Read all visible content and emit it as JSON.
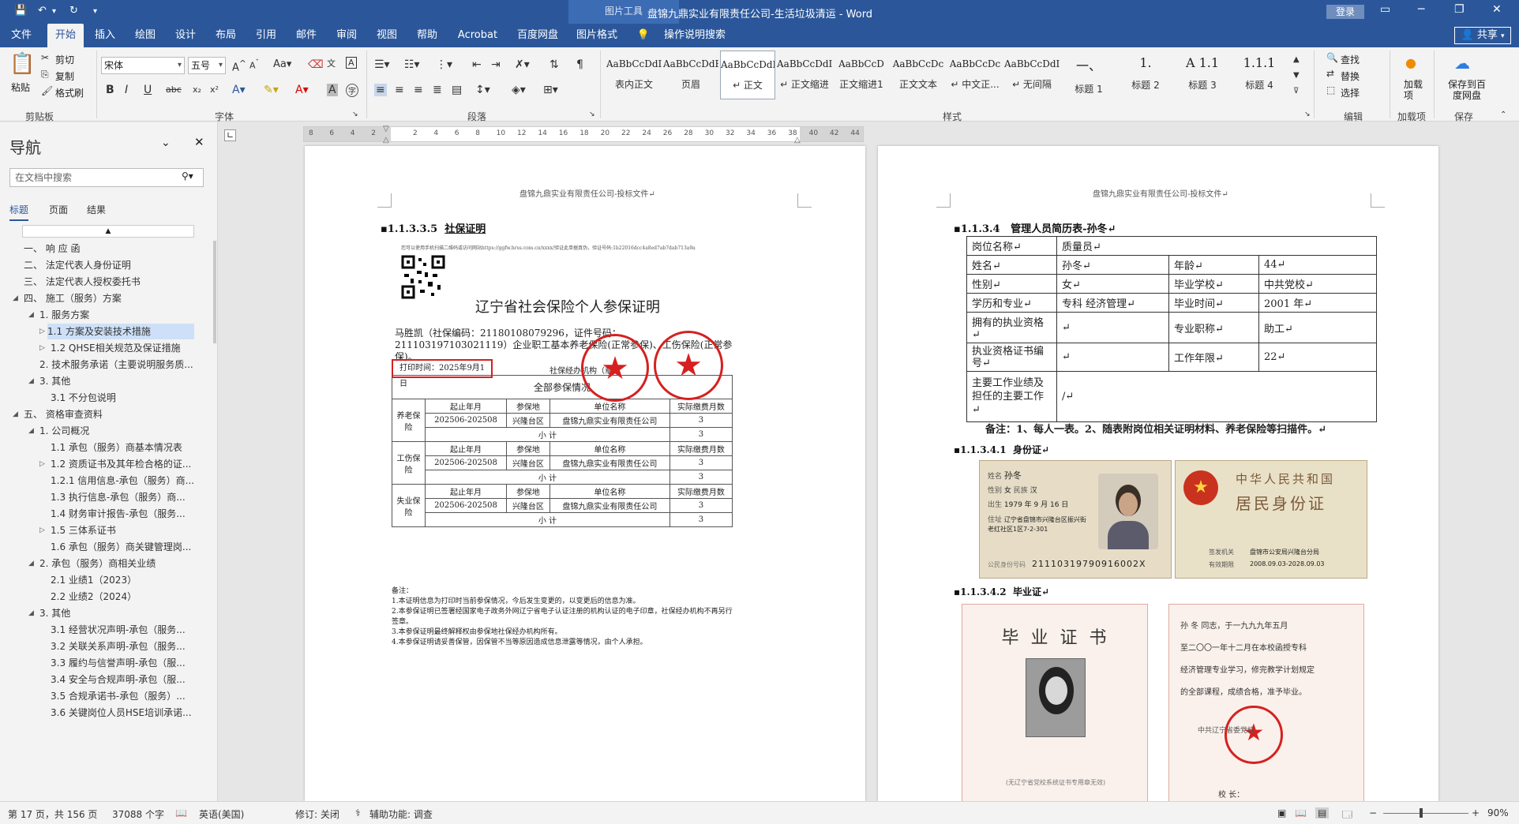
{
  "titlebar": {
    "context_tab": "图片工具",
    "document_title": "盘锦九鼎实业有限责任公司-生活垃圾清运 - Word",
    "login": "登录",
    "save_icon": "save-icon",
    "undo_icon": "undo-icon",
    "redo_icon": "redo-icon"
  },
  "tabs": [
    "文件",
    "开始",
    "插入",
    "绘图",
    "设计",
    "布局",
    "引用",
    "邮件",
    "审阅",
    "视图",
    "帮助",
    "Acrobat",
    "百度网盘",
    "图片格式"
  ],
  "tell_me": "操作说明搜索",
  "share": "共享",
  "ribbon": {
    "clipboard": {
      "paste": "粘贴",
      "cut": "剪切",
      "copy": "复制",
      "format_painter": "格式刷",
      "label": "剪贴板"
    },
    "font": {
      "name": "宋体",
      "size": "五号",
      "label": "字体"
    },
    "paragraph": {
      "label": "段落"
    },
    "styles": {
      "label": "样式",
      "items": [
        {
          "sample": "AaBbCcDdI",
          "name": "表内正文"
        },
        {
          "sample": "AaBbCcDdEe",
          "name": "页眉"
        },
        {
          "sample": "AaBbCcDdI",
          "name": "↵ 正文"
        },
        {
          "sample": "AaBbCcDdI",
          "name": "↵ 正文缩进"
        },
        {
          "sample": "AaBbCcD",
          "name": "正文缩进1"
        },
        {
          "sample": "AaBbCcDc",
          "name": "正文文本"
        },
        {
          "sample": "AaBbCcDc",
          "name": "↵ 中文正..."
        },
        {
          "sample": "AaBbCcDdI",
          "name": "↵ 无间隔"
        },
        {
          "sample": "一、",
          "name": "标题 1"
        },
        {
          "sample": "1.",
          "name": "标题 2"
        },
        {
          "sample": "A 1.1",
          "name": "标题 3"
        },
        {
          "sample": "1.1.1",
          "name": "标题 4"
        }
      ]
    },
    "editing": {
      "find": "查找",
      "replace": "替换",
      "select": "选择",
      "label": "编辑"
    },
    "addins": {
      "add": "加载项",
      "label": "加载项"
    },
    "save": {
      "btn": "保存到百度网盘",
      "label": "保存"
    }
  },
  "ruler_ticks": [
    "8",
    "6",
    "4",
    "2",
    "",
    "2",
    "4",
    "6",
    "8",
    "10",
    "12",
    "14",
    "16",
    "18",
    "20",
    "22",
    "24",
    "26",
    "28",
    "30",
    "32",
    "34",
    "36",
    "38",
    "40",
    "42",
    "44"
  ],
  "nav": {
    "title": "导航",
    "search_placeholder": "在文档中搜索",
    "tabs": [
      "标题",
      "页面",
      "结果"
    ],
    "items": [
      {
        "text": "一、 响 应 函",
        "indent": 0
      },
      {
        "text": "二、 法定代表人身份证明",
        "indent": 0
      },
      {
        "text": "三、 法定代表人授权委托书",
        "indent": 0
      },
      {
        "text": "四、 施工（服务）方案",
        "indent": 0,
        "caret": true
      },
      {
        "text": "1. 服务方案",
        "indent": 1,
        "caret": true
      },
      {
        "text": "1.1 方案及安装技术措施",
        "indent": 2,
        "caret": true,
        "selected": true
      },
      {
        "text": "1.2 QHSE相关规范及保证措施",
        "indent": 2,
        "caret": true
      },
      {
        "text": "2. 技术服务承诺（主要说明服务质...",
        "indent": 1
      },
      {
        "text": "3. 其他",
        "indent": 1,
        "caret": true
      },
      {
        "text": "3.1 不分包说明",
        "indent": 2
      },
      {
        "text": "五、 资格审查资料",
        "indent": 0,
        "caret": true
      },
      {
        "text": "1. 公司概况",
        "indent": 1,
        "caret": true
      },
      {
        "text": "1.1 承包（服务）商基本情况表",
        "indent": 2
      },
      {
        "text": "1.2 资质证书及其年检合格的证...",
        "indent": 2,
        "caret": true
      },
      {
        "text": "1.2.1 信用信息-承包（服务）商...",
        "indent": 2
      },
      {
        "text": "1.3 执行信息-承包（服务）商...",
        "indent": 2
      },
      {
        "text": "1.4 财务审计报告-承包（服务...",
        "indent": 2
      },
      {
        "text": "1.5 三体系证书",
        "indent": 2,
        "caret": true
      },
      {
        "text": "1.6 承包（服务）商关键管理岗...",
        "indent": 2
      },
      {
        "text": "2. 承包（服务）商相关业绩",
        "indent": 1,
        "caret": true
      },
      {
        "text": "2.1 业绩1（2023）",
        "indent": 2
      },
      {
        "text": "2.2 业绩2（2024）",
        "indent": 2
      },
      {
        "text": "3. 其他",
        "indent": 1,
        "caret": true
      },
      {
        "text": "3.1 经营状况声明-承包（服务...",
        "indent": 2
      },
      {
        "text": "3.2 关联关系声明-承包（服务...",
        "indent": 2
      },
      {
        "text": "3.3 履约与信誉声明-承包（服...",
        "indent": 2
      },
      {
        "text": "3.4 安全与合规声明-承包（服...",
        "indent": 2
      },
      {
        "text": "3.5 合规承诺书-承包（服务）...",
        "indent": 2
      },
      {
        "text": "3.6 关键岗位人员HSE培训承诺...",
        "indent": 2
      }
    ]
  },
  "page1": {
    "header": "盘锦九鼎实业有限责任公司-投标文件↵",
    "heading_num": "1.1.3.3.5",
    "heading_text": "社保证明",
    "verify_line": "您可以使用手机扫描二维码或访问网站https://ggfw.hrss.com.cn/xxxx/验证此单据真伪，验证号码:1b22016dcc4a8ed7ab7dab713a9a",
    "cert_title": "辽宁省社会保险个人参保证明",
    "cert_body": "马胜凯（社保编码：21180108079296，证件号码：211103197103021119）企业职工基本养老保险(正常参保)、工伤保险(正常参保)。",
    "print_time": "打印时间：2025年9月1日",
    "agency": "社保经办机构（章）",
    "table_title": "全部参保情况",
    "col_headers": [
      "起止年月",
      "参保地",
      "单位名称",
      "实际缴费月数"
    ],
    "rows": [
      {
        "type": "养老保险",
        "period": "202506-202508",
        "place": "兴隆台区",
        "unit": "盘锦九鼎实业有限责任公司",
        "months": "3"
      },
      {
        "type": "工伤保险",
        "period": "202506-202508",
        "place": "兴隆台区",
        "unit": "盘锦九鼎实业有限责任公司",
        "months": "3"
      },
      {
        "type": "失业保险",
        "period": "202506-202508",
        "place": "兴隆台区",
        "unit": "盘锦九鼎实业有限责任公司",
        "months": "3"
      }
    ],
    "subtotal_label": "小    计",
    "notes": [
      "备注：",
      "1.本证明信息为打印时当前参保情况，今后发生变更的，以变更后的信息为准。",
      "2.本参保证明已签署经国家电子政务外网辽宁省电子认证注册的机构认证的电子印章，社保经办机构不再另行签章。",
      "3.本参保证明最终解释权由参保地社保经办机构所有。",
      "4.本参保证明请妥善保管，因保管不当等原因造成信息泄露等情况，由个人承担。"
    ],
    "seal1_text": "盘锦市社会保险事业服务中心 网办业务专用章",
    "seal2_text": "盘锦市失业保险业务专用章"
  },
  "page2": {
    "header": "盘锦九鼎实业有限责任公司-投标文件↵",
    "heading_num": "1.1.3.4",
    "heading_text": "管理人员简历表-孙冬↵",
    "table": {
      "post_label": "岗位名称↵",
      "post": "质量员↵",
      "name_label": "姓名↵",
      "name": "孙冬↵",
      "age_label": "年龄↵",
      "age": "44↵",
      "gender_label": "性别↵",
      "gender": "女↵",
      "school_label": "毕业学校↵",
      "school": "中共党校↵",
      "edu_label": "学历和专业↵",
      "edu": "专科 经济管理↵",
      "grad_label": "毕业时间↵",
      "grad": "2001 年↵",
      "license_label": "拥有的执业资格↵",
      "license": "↵",
      "title_label": "专业职称↵",
      "title": "助工↵",
      "cert_no_label": "执业资格证书编号↵",
      "cert_no": "↵",
      "years_label": "工作年限↵",
      "years": "22↵",
      "resume_label": "主要工作业绩及担任的主要工作↵",
      "resume": "/↵"
    },
    "note": "备注：1、每人一表。2、随表附岗位相关证明材料、养老保险等扫描件。↵",
    "id_heading_num": "1.1.3.4.1",
    "id_heading": "身份证↵",
    "id_card": {
      "name_label": "姓名",
      "name": "孙冬",
      "sex_label": "性别",
      "sex": "女",
      "ethnic_label": "民族",
      "ethnic": "汉",
      "birth_label": "出生",
      "birth": "1979 年 9 月 16 日",
      "addr_label": "住址",
      "addr": "辽宁省盘锦市兴隆台区振兴街老红社区1区7-2-301",
      "id_label": "公民身份号码",
      "id_number": "21110319790916002X",
      "back_title1": "中华人民共和国",
      "back_title2": "居民身份证",
      "issuer_label": "签发机关",
      "issuer": "盘锦市公安局兴隆台分局",
      "valid_label": "有效期限",
      "valid": "2008.09.03-2028.09.03"
    },
    "grad_heading_num": "1.1.3.4.2",
    "grad_heading": "毕业证↵",
    "diploma": {
      "title": "毕 业 证 书",
      "footer": "(无辽宁省党校系统证书专用章无效)",
      "line1": "孙 冬 同志，于一九九九年五月",
      "line2": "至二〇〇一年十二月在本校函授专科",
      "line3": "经济管理专业学习，修完教学计划规定",
      "line4": "的全部课程，成绩合格，准予毕业。",
      "seal": "中共辽宁省委党校",
      "principal": "校 长："
    }
  },
  "status": {
    "page": "第 17 页，共 156 页",
    "words": "37088 个字",
    "lang": "英语(美国)",
    "track": "修订: 关闭",
    "access": "辅助功能: 调查",
    "zoom": "90%"
  },
  "colors": {
    "word_blue": "#2b579a",
    "ribbon_bg": "#f3f3f3",
    "seal_red": "#d62020"
  }
}
